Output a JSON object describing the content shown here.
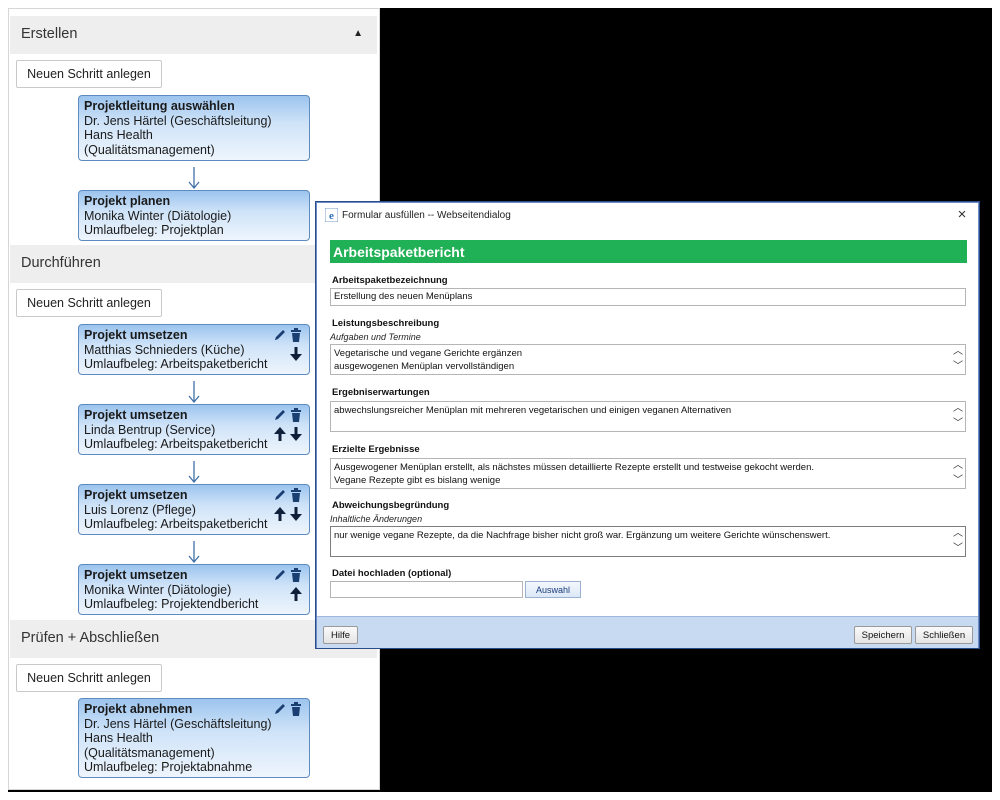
{
  "sections": [
    {
      "title": "Erstellen",
      "caret": "▲",
      "button_label": "Neuen Schritt anlegen",
      "steps": [
        {
          "title": "Projektleitung auswählen",
          "lines": [
            "Dr. Jens Härtel (Geschäftsleitung)",
            "Hans Health",
            "(Qualitätsmanagement)"
          ]
        },
        {
          "title": "Projekt planen",
          "lines": [
            "Monika Winter (Diätologie)",
            "Umlaufbeleg: Projektplan"
          ]
        }
      ]
    },
    {
      "title": "Durchführen",
      "button_label": "Neuen Schritt anlegen",
      "steps": [
        {
          "title": "Projekt umsetzen",
          "lines": [
            "Matthias Schnieders (Küche)",
            "Umlaufbeleg: Arbeitspaketbericht"
          ]
        },
        {
          "title": "Projekt umsetzen",
          "lines": [
            "Linda Bentrup (Service)",
            "Umlaufbeleg: Arbeitspaketbericht"
          ]
        },
        {
          "title": "Projekt umsetzen",
          "lines": [
            "Luis Lorenz (Pflege)",
            "Umlaufbeleg: Arbeitspaketbericht"
          ]
        },
        {
          "title": "Projekt umsetzen",
          "lines": [
            "Monika Winter (Diätologie)",
            "Umlaufbeleg: Projektendbericht"
          ]
        }
      ]
    },
    {
      "title": "Prüfen + Abschließen",
      "button_label": "Neuen Schritt anlegen",
      "steps": [
        {
          "title": "Projekt abnehmen",
          "lines": [
            "Dr. Jens Härtel (Geschäftsleitung)",
            "Hans Health",
            "(Qualitätsmanagement)",
            "Umlaufbeleg: Projektabnahme"
          ]
        }
      ]
    }
  ],
  "dialog": {
    "title": "Formular ausfüllen -- Webseitendialog",
    "close": "×",
    "heading": "Arbeitspaketbericht",
    "fields": {
      "bezeichnung": {
        "label": "Arbeitspaketbezeichnung",
        "value": "Erstellung des neuen Menüplans"
      },
      "leistung": {
        "label": "Leistungsbeschreibung",
        "sublabel": "Aufgaben und Termine",
        "lines": [
          "Vegetarische und vegane Gerichte ergänzen",
          "ausgewogenen Menüplan vervollständigen"
        ]
      },
      "erwartungen": {
        "label": "Ergebniserwartungen",
        "lines": [
          "abwechslungsreicher Menüplan mit mehreren vegetarischen und einigen veganen Alternativen"
        ]
      },
      "ergebnisse": {
        "label": "Erzielte Ergebnisse",
        "lines": [
          "Ausgewogener Menüplan erstellt, als nächstes müssen detaillierte Rezepte erstellt und testweise gekocht werden.",
          "Vegane Rezepte gibt es bislang wenige"
        ]
      },
      "abweichung": {
        "label": "Abweichungsbegründung",
        "sublabel": "Inhaltliche Änderungen",
        "lines": [
          "nur wenige vegane Rezepte, da die Nachfrage bisher nicht groß war. Ergänzung um weitere Gerichte wünschenswert."
        ]
      },
      "upload": {
        "label": "Datei hochladen (optional)",
        "value": "",
        "button": "Auswahl"
      }
    },
    "footer": {
      "help": "Hilfe",
      "save": "Speichern",
      "close": "Schließen"
    },
    "accent_color": "#20b055"
  }
}
